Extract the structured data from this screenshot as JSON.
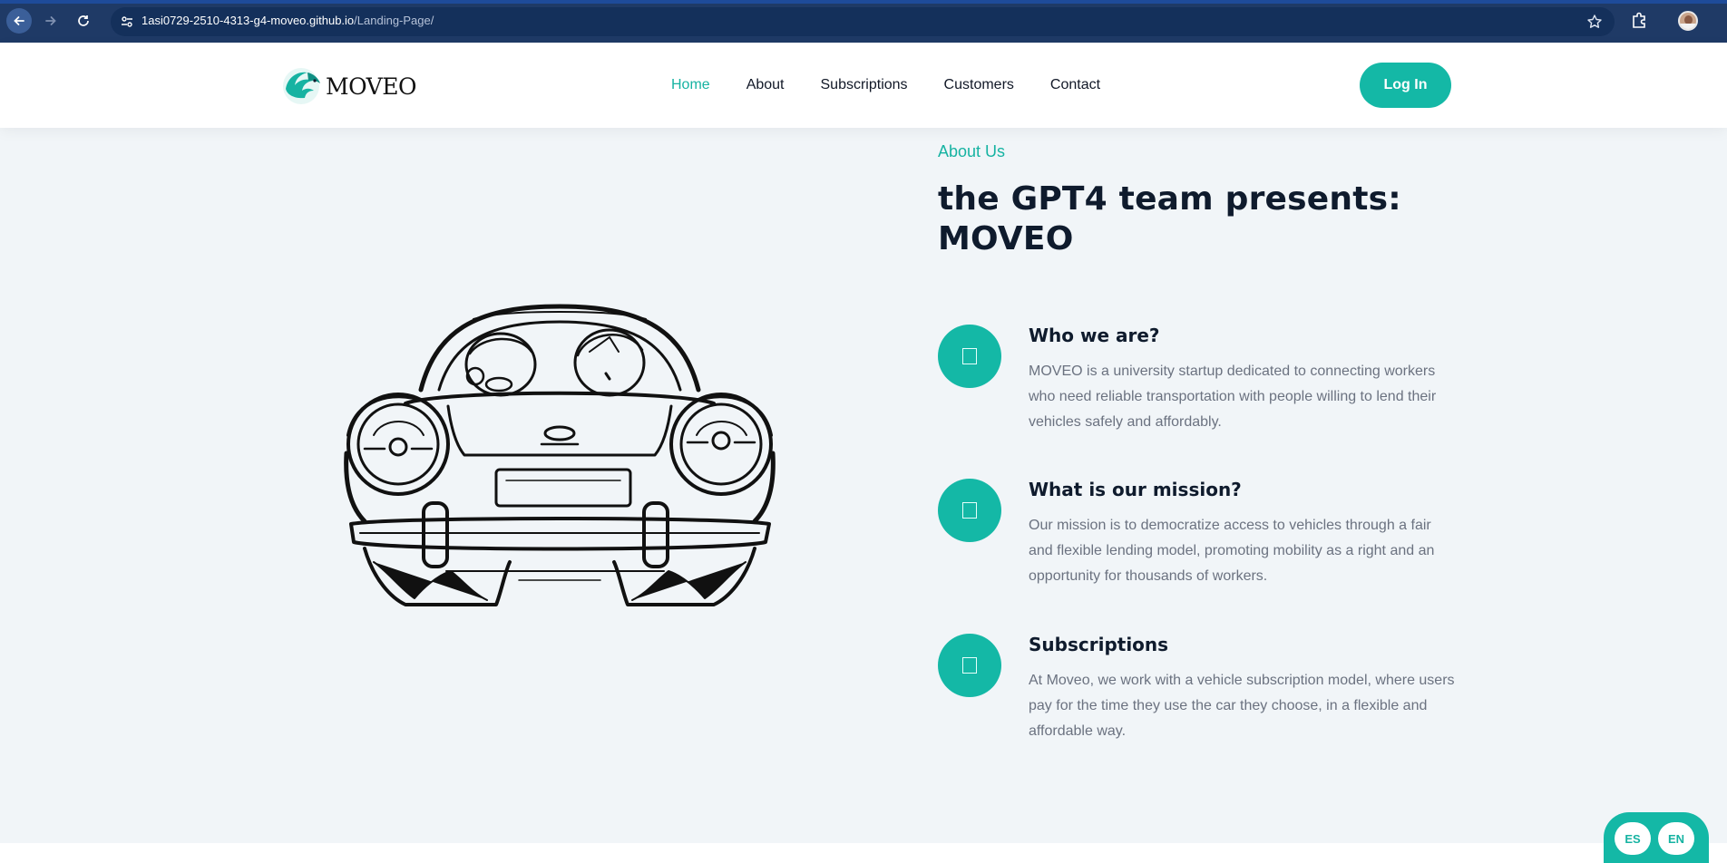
{
  "browser": {
    "url_host": "1asi0729-2510-4313-g4-moveo.github.io",
    "url_path": "/Landing-Page/"
  },
  "header": {
    "logo_text": "MOVEO",
    "nav": [
      {
        "label": "Home",
        "active": true
      },
      {
        "label": "About",
        "active": false
      },
      {
        "label": "Subscriptions",
        "active": false
      },
      {
        "label": "Customers",
        "active": false
      },
      {
        "label": "Contact",
        "active": false
      }
    ],
    "login_label": "Log In"
  },
  "about": {
    "eyebrow": "About Us",
    "headline_line1": "the GPT4 team presents:",
    "headline_line2": "MOVEO",
    "features": [
      {
        "title": "Who we are?",
        "body": "MOVEO is a university startup dedicated to connecting workers who need reliable transportation with people willing to lend their vehicles safely and affordably."
      },
      {
        "title": "What is our mission?",
        "body": "Our mission is to democratize access to vehicles through a fair and flexible lending model, promoting mobility as a right and an opportunity for thousands of workers."
      },
      {
        "title": "Subscriptions",
        "body": "At Moveo, we work with a vehicle subscription model, where users pay for the time they use the car they choose, in a flexible and affordable way."
      }
    ]
  },
  "language": {
    "es": "ES",
    "en": "EN"
  },
  "colors": {
    "accent": "#14b8a6",
    "heading": "#0f1b2d",
    "body_text": "#6b7280",
    "page_bg": "#f1f5f8",
    "chrome_bg": "#1f3a66"
  },
  "icons": [
    "back-arrow-icon",
    "forward-arrow-icon",
    "reload-icon",
    "site-settings-icon",
    "bookmark-star-icon",
    "extensions-icon",
    "profile-avatar",
    "feature-icon"
  ]
}
